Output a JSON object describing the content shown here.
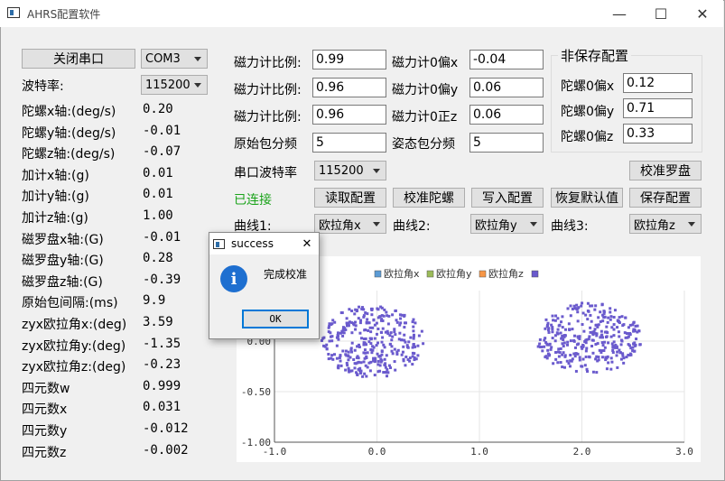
{
  "window": {
    "title": "AHRS配置软件",
    "minimize_glyph": "—",
    "maximize_glyph": "☐",
    "close_glyph": "✕"
  },
  "left": {
    "close_port_label": "关闭串口",
    "port_value": "COM3",
    "baud_label": "波特率:",
    "baud_value": "115200",
    "readings": [
      {
        "label": "陀螺x轴:(deg/s)",
        "value": "0.20"
      },
      {
        "label": "陀螺y轴:(deg/s)",
        "value": "-0.01"
      },
      {
        "label": "陀螺z轴:(deg/s)",
        "value": "-0.07"
      },
      {
        "label": "加计x轴:(g)",
        "value": "0.01"
      },
      {
        "label": "加计y轴:(g)",
        "value": "0.01"
      },
      {
        "label": "加计z轴:(g)",
        "value": "1.00"
      },
      {
        "label": "磁罗盘x轴:(G)",
        "value": "-0.01"
      },
      {
        "label": "磁罗盘y轴:(G)",
        "value": "0.28"
      },
      {
        "label": "磁罗盘z轴:(G)",
        "value": "-0.39"
      },
      {
        "label": "原始包间隔:(ms)",
        "value": "9.9"
      },
      {
        "label": "zyx欧拉角x:(deg)",
        "value": "3.59"
      },
      {
        "label": "zyx欧拉角y:(deg)",
        "value": "-1.35"
      },
      {
        "label": "zyx欧拉角z:(deg)",
        "value": "-0.23"
      },
      {
        "label": "四元数w",
        "value": "0.999"
      },
      {
        "label": "四元数x",
        "value": "0.031"
      },
      {
        "label": "四元数y",
        "value": "-0.012"
      },
      {
        "label": "四元数z",
        "value": "-0.002"
      }
    ]
  },
  "config": {
    "mag_scale": [
      {
        "label": "磁力计比例:",
        "value": "0.99"
      },
      {
        "label": "磁力计比例:",
        "value": "0.96"
      },
      {
        "label": "磁力计比例:",
        "value": "0.96"
      }
    ],
    "mag_offset": [
      {
        "label": "磁力计0偏x",
        "value": "-0.04"
      },
      {
        "label": "磁力计0偏y",
        "value": "0.06"
      },
      {
        "label": "磁力计0正z",
        "value": "0.06"
      }
    ],
    "raw_div_label": "原始包分频",
    "raw_div_value": "5",
    "att_div_label": "姿态包分频",
    "att_div_value": "5",
    "serial_baud_label": "串口波特率",
    "serial_baud_value": "115200",
    "calib_compass_label": "校准罗盘",
    "status": "已连接",
    "status_color": "#1aa31a",
    "buttons": {
      "read": "读取配置",
      "calib_gyro": "校准陀螺",
      "write": "写入配置",
      "restore": "恢复默认值",
      "save": "保存配置"
    },
    "curve1_label": "曲线1:",
    "curve1_value": "欧拉角x",
    "curve2_label": "曲线2:",
    "curve2_value": "欧拉角y",
    "curve3_label": "曲线3:",
    "curve3_value": "欧拉角z"
  },
  "nonsave": {
    "title": "非保存配置",
    "items": [
      {
        "label": "陀螺0偏x",
        "value": "0.12"
      },
      {
        "label": "陀螺0偏y",
        "value": "0.71"
      },
      {
        "label": "陀螺0偏z",
        "value": "0.33"
      }
    ]
  },
  "dialog": {
    "title": "success",
    "message": "完成校准",
    "ok_label": "OK",
    "close_glyph": "✕",
    "icon_glyph": "i"
  },
  "chart_data": {
    "type": "scatter",
    "legend": [
      "欧拉角x",
      "欧拉角y",
      "欧拉角z",
      ""
    ],
    "legend_colors": [
      "#5b9bd5",
      "#9bbb59",
      "#f79646",
      "#6a5acd"
    ],
    "point_color": "#6a5acd",
    "xlim": [
      -1.0,
      3.0
    ],
    "ylim": [
      -1.0,
      0.5
    ],
    "x_ticks": [
      "-1.0",
      "0.0",
      "1.0",
      "2.0",
      "3.0"
    ],
    "y_ticks": [
      "0.00",
      "-0.50",
      "-1.00"
    ],
    "clusters": [
      {
        "center": [
          -0.04,
          0.0
        ],
        "radius_x": 0.5,
        "radius_y": 0.36
      },
      {
        "center": [
          2.07,
          0.03
        ],
        "radius_x": 0.52,
        "radius_y": 0.35
      }
    ],
    "grid": true,
    "legend_position": "top"
  }
}
